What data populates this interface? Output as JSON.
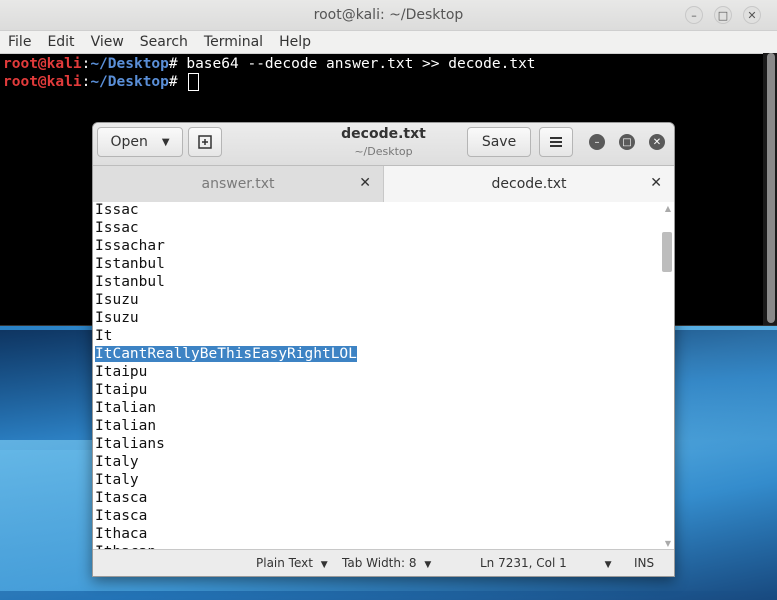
{
  "terminal": {
    "title": "root@kali: ~/Desktop",
    "menu": [
      "File",
      "Edit",
      "View",
      "Search",
      "Terminal",
      "Help"
    ],
    "lines": [
      {
        "user": "root@kali",
        "path": "~/Desktop",
        "cmd": "# base64 --decode answer.txt >> decode.txt"
      },
      {
        "user": "root@kali",
        "path": "~/Desktop",
        "cmd": "# "
      }
    ]
  },
  "gedit": {
    "open_label": "Open",
    "save_label": "Save",
    "title": "decode.txt",
    "subtitle": "~/Desktop",
    "tabs": [
      {
        "label": "answer.txt",
        "active": false
      },
      {
        "label": "decode.txt",
        "active": true
      }
    ],
    "lines": [
      "Issac",
      "Issac",
      "Issachar",
      "Istanbul",
      "Istanbul",
      "Isuzu",
      "Isuzu",
      "It",
      "ItCantReallyBeThisEasyRightLOL",
      "Itaipu",
      "Itaipu",
      "Italian",
      "Italian",
      "Italians",
      "Italy",
      "Italy",
      "Itasca",
      "Itasca",
      "Ithaca",
      "Ithacan"
    ],
    "selected_line": "ItCantReallyBeThisEasyRightLOL",
    "status": {
      "language": "Plain Text",
      "tab_width": "Tab Width: 8",
      "position": "Ln 7231, Col 1",
      "mode": "INS"
    }
  },
  "colors": {
    "selection": "#3d83c4",
    "prompt_user": "#e23b3b",
    "prompt_path": "#5a8fd8"
  }
}
